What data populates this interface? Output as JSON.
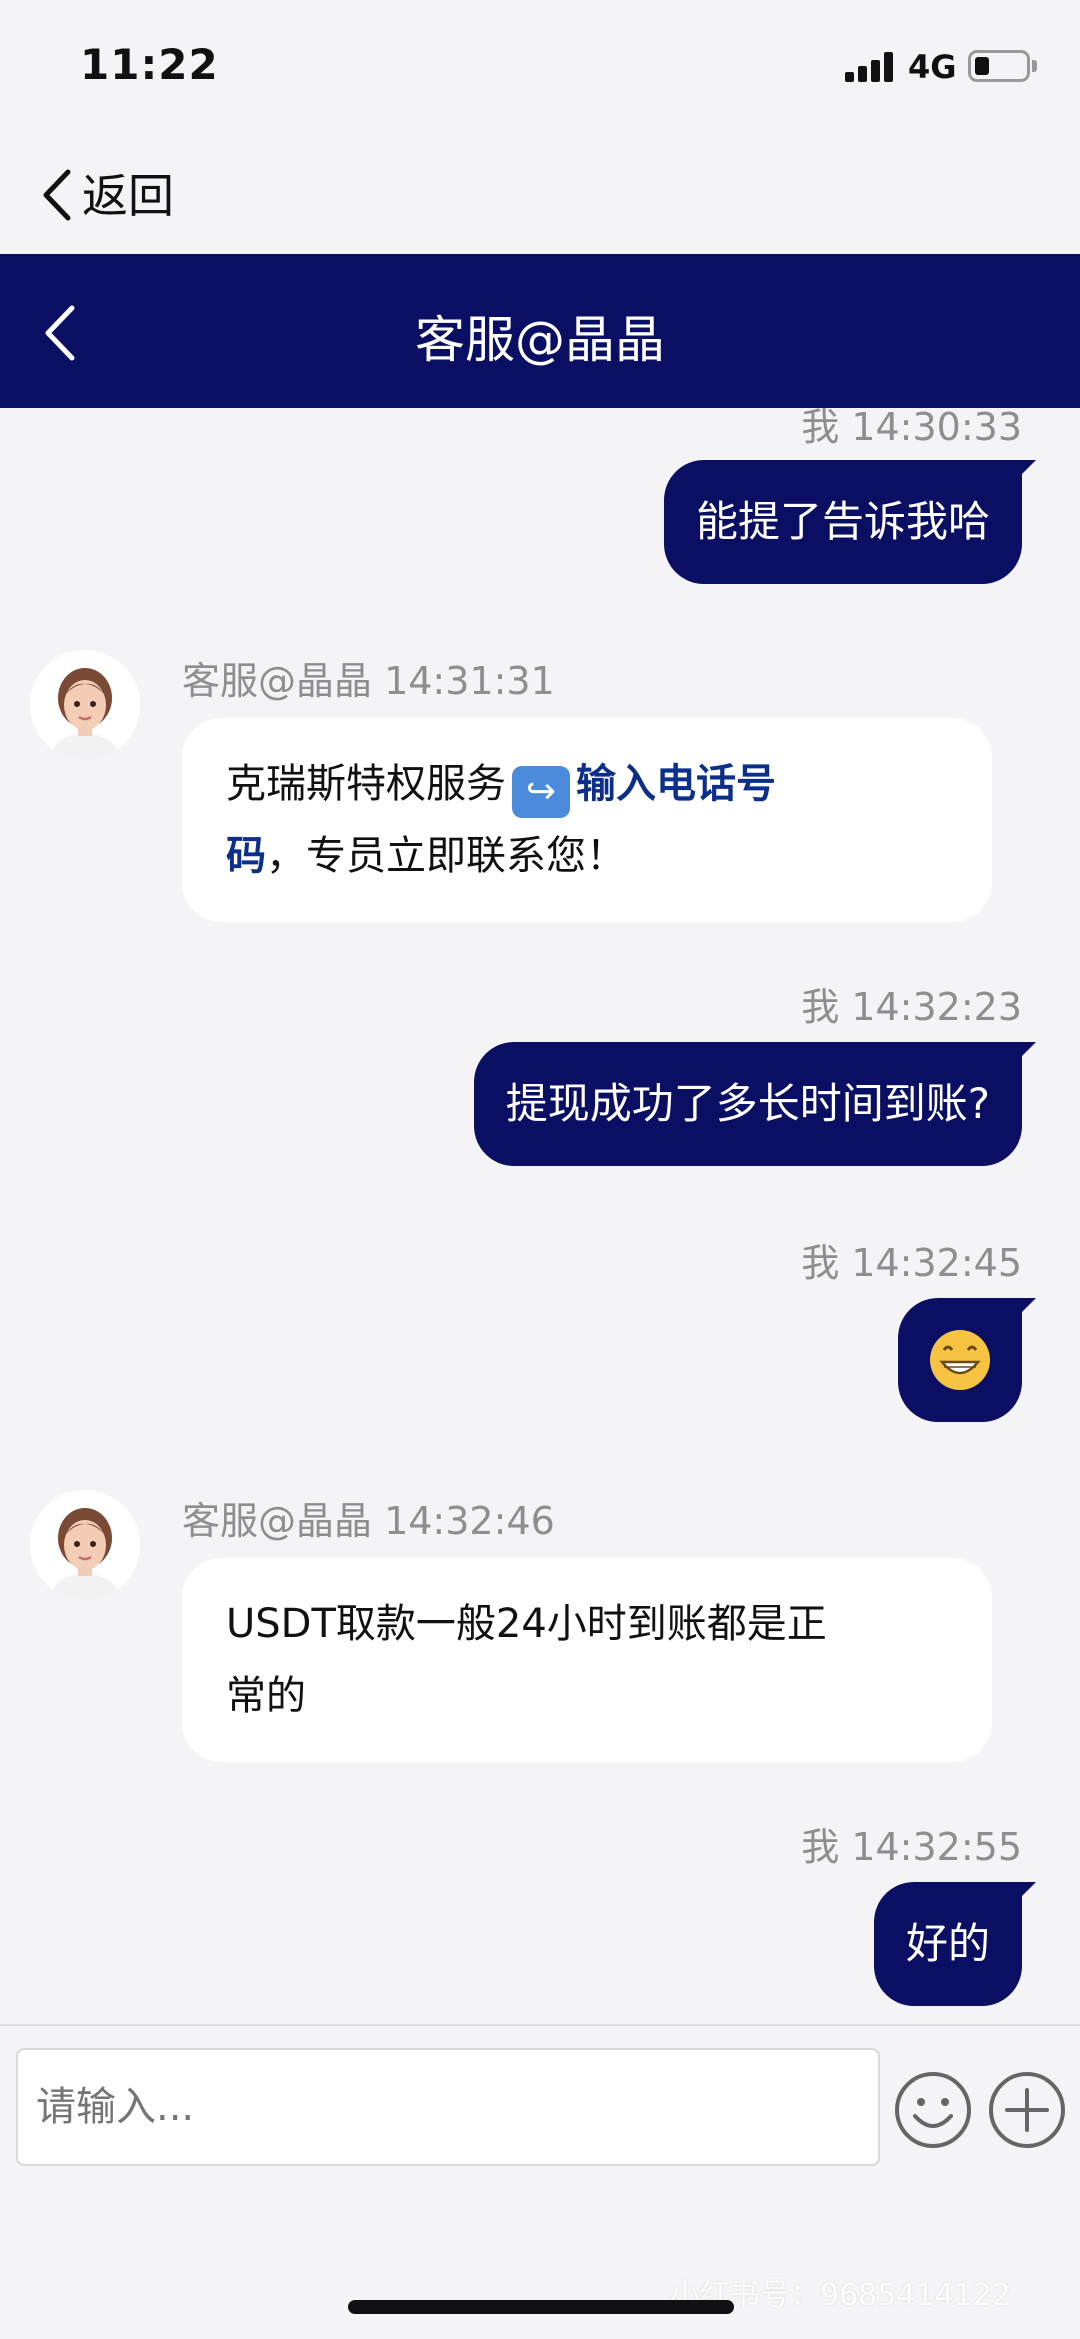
{
  "status": {
    "time": "11:22",
    "network": "4G"
  },
  "back": {
    "label": "返回"
  },
  "header": {
    "title": "客服@晶晶"
  },
  "messages": {
    "m0": {
      "meta": "我 14:30:33"
    },
    "m1": {
      "text": "能提了告诉我哈"
    },
    "m2": {
      "meta": "客服@晶晶 14:31:31",
      "text_before": "克瑞斯特权服务",
      "icon": "return-arrow-icon",
      "link_part1": "输入电话号",
      "link_part2": "码",
      "text_after": "，专员立即联系您！"
    },
    "m3": {
      "meta": "我 14:32:23",
      "text": "提现成功了多长时间到账?"
    },
    "m4": {
      "meta": "我 14:32:45",
      "emoji": "grinning-face-emoji"
    },
    "m5": {
      "meta": "客服@晶晶 14:32:46",
      "line1": "USDT取款一般24小时到账都是正",
      "line2": "常的"
    },
    "m6": {
      "meta": "我 14:32:55",
      "text": "好的"
    }
  },
  "input": {
    "placeholder": "请输入..."
  },
  "watermark": "小红书号：9685414122",
  "colors": {
    "header": "#0a0f63",
    "link": "#0b2f8a",
    "background": "#f4f4f6"
  }
}
